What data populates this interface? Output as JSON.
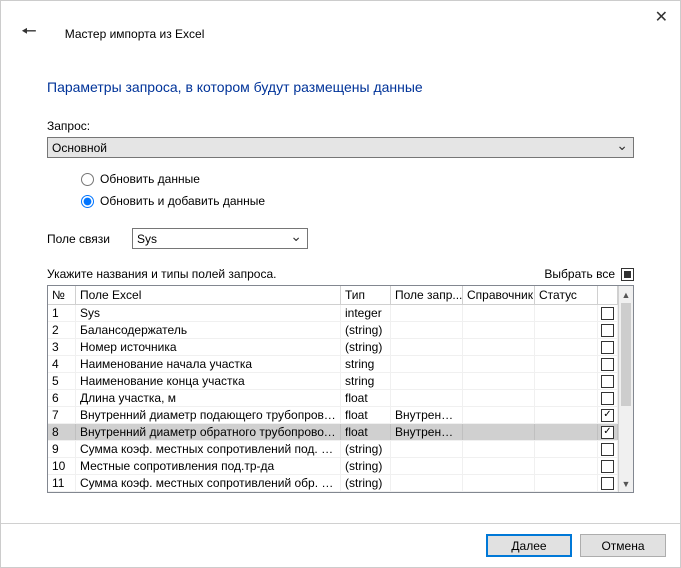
{
  "window": {
    "title": "Мастер импорта из Excel"
  },
  "page": {
    "title": "Параметры запроса, в котором будут размещены данные"
  },
  "query": {
    "label": "Запрос:",
    "value": "Основной"
  },
  "mode": {
    "update_label": "Обновить данные",
    "update_add_label": "Обновить и добавить данные",
    "selected": "update_add"
  },
  "link_field": {
    "label": "Поле связи",
    "value": "Sys"
  },
  "hint": "Укажите названия и типы полей запроса.",
  "select_all": {
    "label": "Выбрать все",
    "state": "indeterminate"
  },
  "grid": {
    "headers": {
      "n": "№",
      "excel": "Поле Excel",
      "type": "Тип",
      "zapr": "Поле запр...",
      "spr": "Справочник",
      "stat": "Статус",
      "chk": ""
    },
    "rows": [
      {
        "n": "1",
        "excel": "Sys",
        "type": "integer",
        "zapr": "",
        "spr": "",
        "stat": "",
        "chk": false
      },
      {
        "n": "2",
        "excel": "Балансодержатель",
        "type": "(string)",
        "zapr": "",
        "spr": "",
        "stat": "",
        "chk": false
      },
      {
        "n": "3",
        "excel": "Номер источника",
        "type": "(string)",
        "zapr": "",
        "spr": "",
        "stat": "",
        "chk": false
      },
      {
        "n": "4",
        "excel": "Наименование начала участка",
        "type": "string",
        "zapr": "",
        "spr": "",
        "stat": "",
        "chk": false
      },
      {
        "n": "5",
        "excel": "Наименование конца участка",
        "type": "string",
        "zapr": "",
        "spr": "",
        "stat": "",
        "chk": false
      },
      {
        "n": "6",
        "excel": "Длина участка, м",
        "type": "float",
        "zapr": "",
        "spr": "",
        "stat": "",
        "chk": false
      },
      {
        "n": "7",
        "excel": "Внутренний диаметр подающего трубопровода, м",
        "type": "float",
        "zapr": "Внутренни...",
        "spr": "",
        "stat": "",
        "chk": true
      },
      {
        "n": "8",
        "excel": "Внутренний диаметр обратного трубопровода, м",
        "type": "float",
        "zapr": "Внутренни...",
        "spr": "",
        "stat": "",
        "chk": true,
        "selected": true
      },
      {
        "n": "9",
        "excel": "Сумма коэф. местных сопротивлений под. тр-да",
        "type": "(string)",
        "zapr": "",
        "spr": "",
        "stat": "",
        "chk": false
      },
      {
        "n": "10",
        "excel": "Местные сопротивления под.тр-да",
        "type": "(string)",
        "zapr": "",
        "spr": "",
        "stat": "",
        "chk": false
      },
      {
        "n": "11",
        "excel": "Сумма коэф. местных сопротивлений обр. тр-да",
        "type": "(string)",
        "zapr": "",
        "spr": "",
        "stat": "",
        "chk": false
      }
    ]
  },
  "footer": {
    "next": "Далее",
    "cancel": "Отмена"
  }
}
